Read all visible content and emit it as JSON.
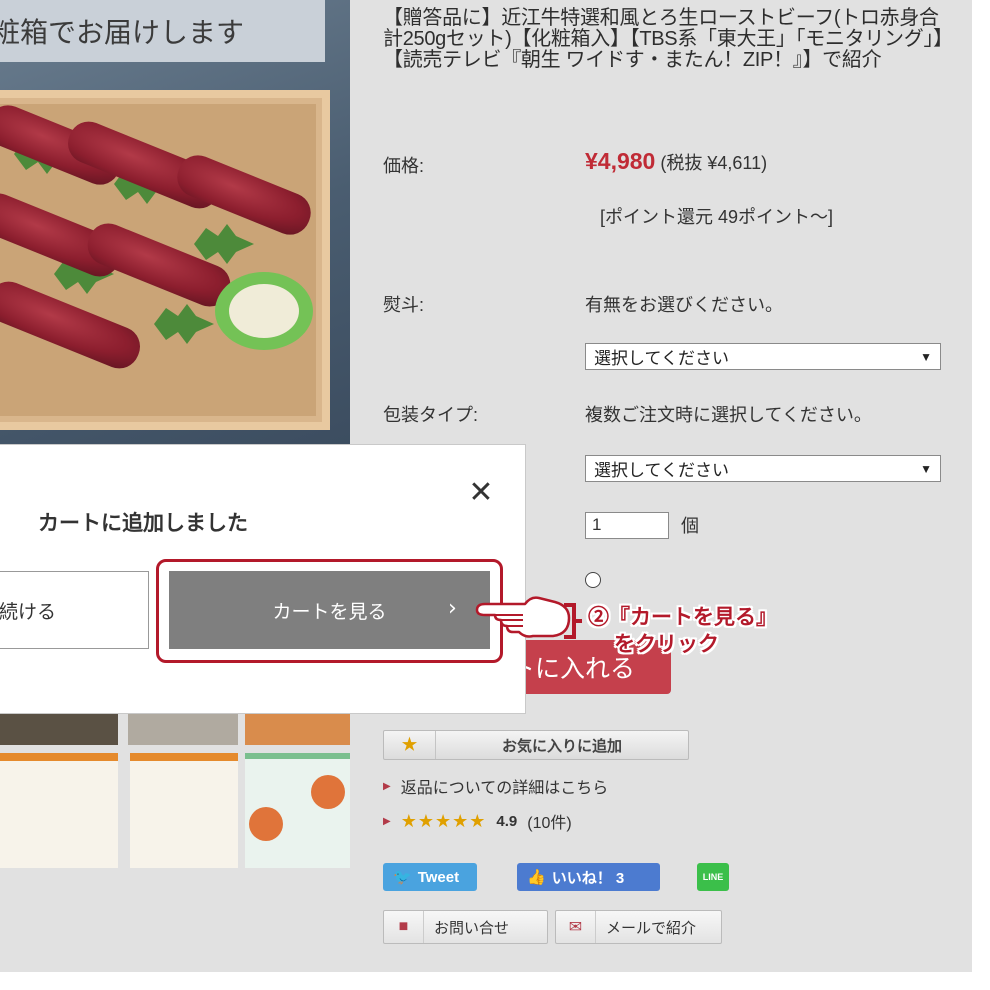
{
  "product": {
    "banner_text": "粧箱でお届けします",
    "title": "【贈答品に】近江牛特選和風とろ生ローストビーフ(トロ赤身合計250gセット)【化粧箱入】【TBS系「東大王」「モニタリング」】【読売テレビ『朝生 ワイドす・またん！ZIP！』】で紹介"
  },
  "price": {
    "label": "価格:",
    "value": "¥4,980",
    "tax_note": "(税抜 ¥4,611)",
    "points": "[ポイント還元 49ポイント～]"
  },
  "noshi": {
    "label": "熨斗:",
    "prompt": "有無をお選びください。",
    "select_value": "選択してください"
  },
  "wrapping": {
    "label": "包装タイプ:",
    "prompt": "複数ご注文時に選択してください。",
    "select_value": "選択してください"
  },
  "quantity": {
    "value": "1",
    "unit": "個"
  },
  "add_to_cart_label": "トに入れる",
  "favorite_label": "お気に入りに追加",
  "returns_link": "返品についての詳細はこちら",
  "rating": {
    "stars": "★★★★★",
    "score": "4.9",
    "count": "(10件)"
  },
  "social": {
    "tweet": "Tweet",
    "like": "いいね！ 3",
    "line": "LINE"
  },
  "contact": {
    "inquiry": "お問い合せ",
    "mail": "メールで紹介"
  },
  "modal": {
    "title": "カートに追加しました",
    "continue_label": "続ける",
    "view_cart_label": "カートを見る",
    "close_icon": "close-icon"
  },
  "annotation": {
    "line1": "②『カートを見る』",
    "line2": "をクリック"
  },
  "colors": {
    "price_red": "#c02b36",
    "highlight_red": "#b3192a",
    "view_cart_gray": "#7f7f7f",
    "page_bg": "#e1e1e1"
  }
}
